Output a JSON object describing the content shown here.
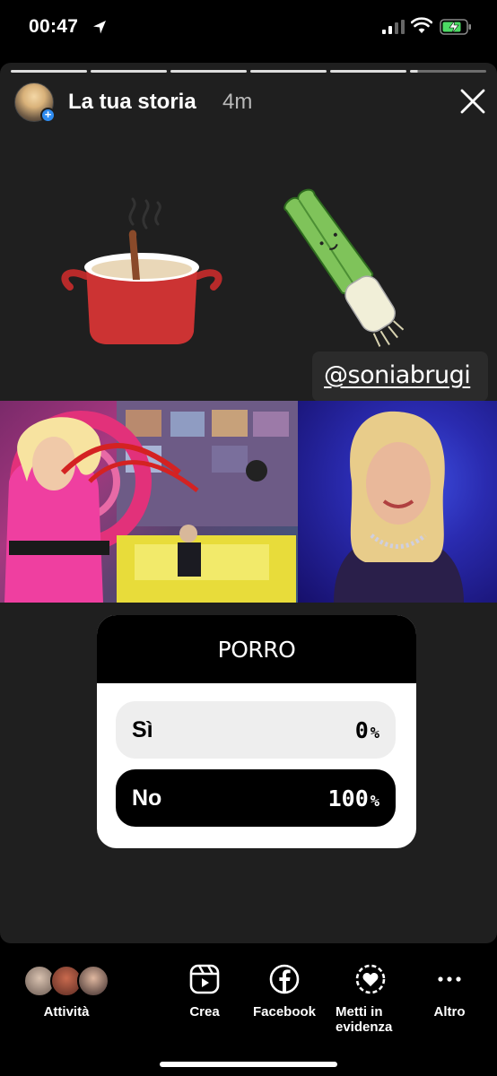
{
  "status_bar": {
    "time": "00:47",
    "icons": [
      "location-arrow-icon",
      "cellular-signal-icon",
      "wifi-icon",
      "battery-charging-icon"
    ],
    "battery_color": "#4cd964"
  },
  "story": {
    "title": "La tua storia",
    "time_ago": "4m",
    "progress_segments": 6,
    "mention": "@soniabrugi",
    "stickers": [
      "cooking-pot-sticker",
      "leek-sticker"
    ],
    "poll": {
      "question": "PORRO",
      "options": [
        {
          "label": "Sì",
          "percent": "0",
          "unit": "%"
        },
        {
          "label": "No",
          "percent": "100",
          "unit": "%"
        }
      ]
    }
  },
  "bottom_bar": {
    "items": [
      {
        "label": "Attività",
        "icon": "activity-avatars"
      },
      {
        "label": "Crea",
        "icon": "reels-icon"
      },
      {
        "label": "Facebook",
        "icon": "facebook-icon"
      },
      {
        "label": "Metti in",
        "label2": "evidenza",
        "icon": "highlight-icon"
      },
      {
        "label": "Altro",
        "icon": "more-icon"
      }
    ]
  },
  "colors": {
    "accent": "#2f8cf0",
    "story_bg": "#1f1f1f"
  }
}
